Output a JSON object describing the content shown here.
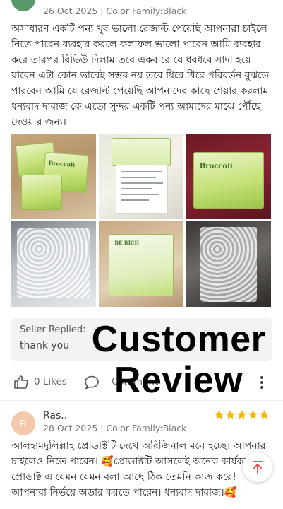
{
  "colors": {
    "star": "#f7b500",
    "scroll_top": "#e8545a",
    "avatar_bg": "#f5c8a9",
    "overlay_text": "#000000"
  },
  "review1": {
    "meta": "26 Oct 2025 | Color Family:Black",
    "text": "অসাধারণ একটি পন্য খুব ভালো রেজাল্ট পেয়েছি আপনারা চাইলে নিতে পারেন ব্যবহার করলে ফলাফল ভালো পাবেন আমি ব্যবহার করে তারপর রিভিউ দিলাম তবে একবারে যে ধবধবে সাদা হয়ে যাবেন এটা কোন ভাবেই সম্ভব নয় তবে ধিরে ধিরে পরিবর্তন বুঝতে পারবেন আমি যে রেজাল্ট পেয়েছি আপনাদের কাছে শেয়ার করলাম ধন্যবাদ দারাজ কে এতো সুন্দর একটি পন্য আমাদের মাঝে পৌঁছে দেওয়ার জন্য।",
    "photos": {
      "product_label": "Broccoli",
      "brand_label": "BE RICH"
    },
    "seller_reply": {
      "label": "Seller Replied:",
      "text": "thank you"
    },
    "likes": "0 Likes",
    "comment_label": "Comment"
  },
  "review2": {
    "avatar_letter": "R",
    "name": "Ras..",
    "meta": "28 Oct 2025 | Color Family:Black",
    "rating": 5,
    "text": "আলহামদুলিল্লাহ প্রোডাক্টটি দেখে অরিজিনাল মনে হচ্ছে। আপনারা চাইলেও নিতে পারেন। 🥰প্রোডাক্টটি আসলেই অনেক কার্যকর। প্রোডাক্ট এ যেমন যেমন বলা আছে ঠিক তেমনি কাজ করে! আপনারা নির্ভয়ে অডার করতে পারেন। ধন্যবাদ দারাজ।🥰"
  },
  "overlay": {
    "line1": "Customer",
    "line2": "Review"
  }
}
